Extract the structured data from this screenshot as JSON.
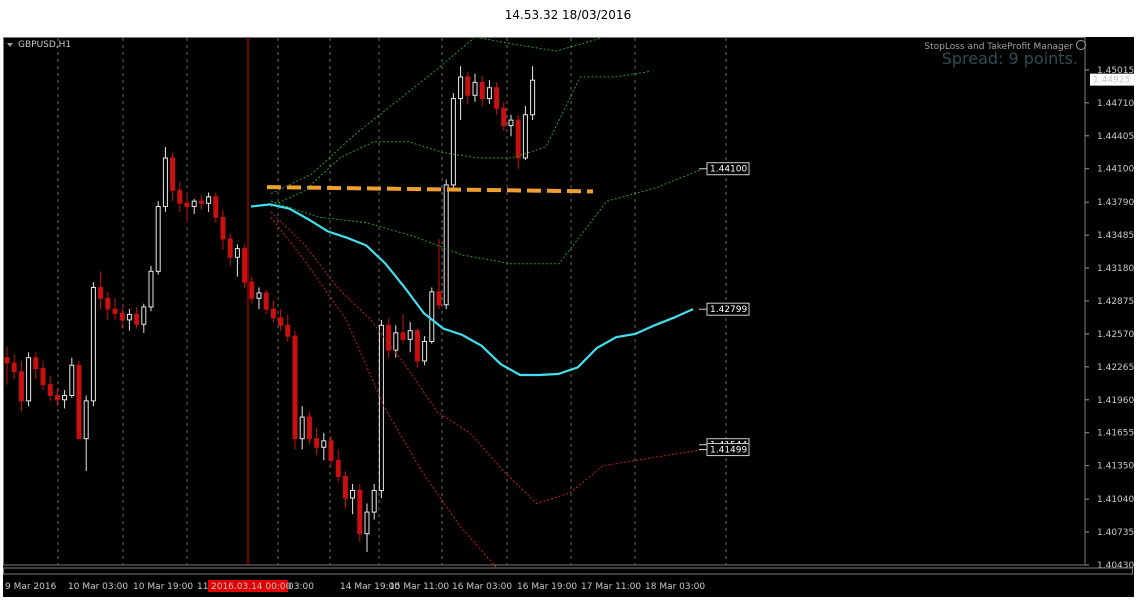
{
  "window": {
    "title": "14.53.32 18/03/2016"
  },
  "chart_header": {
    "symbol": "GBPUSD,H1"
  },
  "indicator": {
    "manager_label": "StopLoss and TakeProfit Manager",
    "spread_label": "Spread: 9 points."
  },
  "chart_data": {
    "type": "line",
    "symbol": "GBPUSD",
    "timeframe": "H1",
    "y_ticks": [
      "1.45015",
      "1.44710",
      "1.44405",
      "1.44100",
      "1.43790",
      "1.43485",
      "1.43180",
      "1.42875",
      "1.42570",
      "1.42265",
      "1.41960",
      "1.41655",
      "1.41350",
      "1.41040",
      "1.40735",
      "1.40430"
    ],
    "ylim": [
      1.4043,
      1.4532
    ],
    "current_price": "1.44925",
    "x_ticks": [
      "9 Mar 2016",
      "10 Mar 03:00",
      "10 Mar 19:00",
      "11",
      "03:00",
      "14 Mar 19:00",
      "15 Mar 11:00",
      "16 Mar 03:00",
      "16 Mar 19:00",
      "17 Mar 11:00",
      "18 Mar 03:00"
    ],
    "highlighted_time": "2016.03.14 00:00",
    "level_labels": [
      {
        "label": "1.44100",
        "value": 1.441
      },
      {
        "label": "1.42799",
        "value": 1.42799
      },
      {
        "label": "1.41544",
        "value": 1.41544
      },
      {
        "label": "1.41499",
        "value": 1.41499
      }
    ],
    "grid": true,
    "series": [
      {
        "color": "#40e0f0",
        "style": "solid",
        "values": [
          1.4375,
          1.4377,
          1.4373,
          1.4363,
          1.4352,
          1.4346,
          1.4339,
          1.4322,
          1.43,
          1.4276,
          1.4262,
          1.4256,
          1.4246,
          1.4229,
          1.4219,
          1.4219,
          1.422,
          1.4226,
          1.4244,
          1.4254,
          1.4257,
          1.4265,
          1.4272,
          1.428
        ]
      },
      {
        "color": "#f0a030",
        "style": "dashed",
        "values": [
          1.4393,
          1.4389
        ]
      },
      {
        "color": "#2a9d2a",
        "style": "dotted",
        "values": [
          1.4387,
          1.4405,
          1.444,
          1.447,
          1.45,
          1.4532,
          1.4525,
          1.4519,
          1.453,
          1.4545,
          1.456
        ]
      },
      {
        "color": "#2a9d2a",
        "style": "dotted",
        "values": [
          1.4375,
          1.439,
          1.442,
          1.4435,
          1.4435,
          1.4425,
          1.442,
          1.442,
          1.443,
          1.4495,
          1.4495,
          1.45
        ]
      },
      {
        "color": "#2a9d2a",
        "style": "dotted",
        "values": [
          1.438,
          1.4365,
          1.436,
          1.4347,
          1.433,
          1.4322,
          1.4322,
          1.438,
          1.4392,
          1.441
        ]
      },
      {
        "color": "#c82020",
        "style": "dotted",
        "values": [
          1.437,
          1.434,
          1.43,
          1.427,
          1.423,
          1.4185,
          1.4165,
          1.413,
          1.41,
          1.411,
          1.4135,
          1.414,
          1.4145,
          1.415
        ]
      },
      {
        "color": "#c82020",
        "style": "dotted",
        "values": [
          1.4365,
          1.432,
          1.427,
          1.419,
          1.413,
          1.408,
          1.404
        ]
      }
    ],
    "candles": [
      {
        "o": 1.4235,
        "h": 1.4245,
        "l": 1.421,
        "c": 1.423
      },
      {
        "o": 1.423,
        "h": 1.4238,
        "l": 1.4215,
        "c": 1.4222
      },
      {
        "o": 1.4222,
        "h": 1.4232,
        "l": 1.4185,
        "c": 1.4195
      },
      {
        "o": 1.4195,
        "h": 1.424,
        "l": 1.419,
        "c": 1.4235
      },
      {
        "o": 1.4235,
        "h": 1.424,
        "l": 1.4215,
        "c": 1.4225
      },
      {
        "o": 1.4225,
        "h": 1.4232,
        "l": 1.4205,
        "c": 1.421
      },
      {
        "o": 1.421,
        "h": 1.4218,
        "l": 1.4195,
        "c": 1.42
      },
      {
        "o": 1.42,
        "h": 1.4206,
        "l": 1.419,
        "c": 1.4196
      },
      {
        "o": 1.4196,
        "h": 1.4205,
        "l": 1.4188,
        "c": 1.42
      },
      {
        "o": 1.42,
        "h": 1.4235,
        "l": 1.4198,
        "c": 1.4228
      },
      {
        "o": 1.4228,
        "h": 1.4232,
        "l": 1.4175,
        "c": 1.416
      },
      {
        "o": 1.416,
        "h": 1.42,
        "l": 1.413,
        "c": 1.4195
      },
      {
        "o": 1.4195,
        "h": 1.4305,
        "l": 1.419,
        "c": 1.43
      },
      {
        "o": 1.43,
        "h": 1.4315,
        "l": 1.428,
        "c": 1.429
      },
      {
        "o": 1.429,
        "h": 1.4296,
        "l": 1.427,
        "c": 1.428
      },
      {
        "o": 1.428,
        "h": 1.429,
        "l": 1.427,
        "c": 1.4276
      },
      {
        "o": 1.4276,
        "h": 1.4282,
        "l": 1.4262,
        "c": 1.427
      },
      {
        "o": 1.427,
        "h": 1.428,
        "l": 1.426,
        "c": 1.4275
      },
      {
        "o": 1.4275,
        "h": 1.4282,
        "l": 1.4262,
        "c": 1.4266
      },
      {
        "o": 1.4266,
        "h": 1.4285,
        "l": 1.4258,
        "c": 1.4282
      },
      {
        "o": 1.4282,
        "h": 1.432,
        "l": 1.4278,
        "c": 1.4315
      },
      {
        "o": 1.4315,
        "h": 1.438,
        "l": 1.4312,
        "c": 1.4375
      },
      {
        "o": 1.4375,
        "h": 1.443,
        "l": 1.437,
        "c": 1.442
      },
      {
        "o": 1.442,
        "h": 1.4425,
        "l": 1.438,
        "c": 1.439
      },
      {
        "o": 1.439,
        "h": 1.4398,
        "l": 1.437,
        "c": 1.4378
      },
      {
        "o": 1.4378,
        "h": 1.4388,
        "l": 1.436,
        "c": 1.4375
      },
      {
        "o": 1.4375,
        "h": 1.4382,
        "l": 1.4368,
        "c": 1.438
      },
      {
        "o": 1.438,
        "h": 1.4386,
        "l": 1.4372,
        "c": 1.4378
      },
      {
        "o": 1.4378,
        "h": 1.4388,
        "l": 1.437,
        "c": 1.4384
      },
      {
        "o": 1.4384,
        "h": 1.4388,
        "l": 1.436,
        "c": 1.4365
      },
      {
        "o": 1.4365,
        "h": 1.4372,
        "l": 1.4335,
        "c": 1.4345
      },
      {
        "o": 1.4345,
        "h": 1.435,
        "l": 1.432,
        "c": 1.4328
      },
      {
        "o": 1.4328,
        "h": 1.434,
        "l": 1.431,
        "c": 1.4336
      },
      {
        "o": 1.4336,
        "h": 1.434,
        "l": 1.43,
        "c": 1.4305
      },
      {
        "o": 1.4305,
        "h": 1.431,
        "l": 1.4285,
        "c": 1.429
      },
      {
        "o": 1.429,
        "h": 1.43,
        "l": 1.428,
        "c": 1.4295
      },
      {
        "o": 1.4295,
        "h": 1.4298,
        "l": 1.4275,
        "c": 1.428
      },
      {
        "o": 1.428,
        "h": 1.4288,
        "l": 1.4268,
        "c": 1.4272
      },
      {
        "o": 1.4272,
        "h": 1.428,
        "l": 1.426,
        "c": 1.4265
      },
      {
        "o": 1.4265,
        "h": 1.4275,
        "l": 1.425,
        "c": 1.4255
      },
      {
        "o": 1.4255,
        "h": 1.426,
        "l": 1.415,
        "c": 1.416
      },
      {
        "o": 1.416,
        "h": 1.419,
        "l": 1.415,
        "c": 1.418
      },
      {
        "o": 1.418,
        "h": 1.4185,
        "l": 1.4155,
        "c": 1.416
      },
      {
        "o": 1.416,
        "h": 1.417,
        "l": 1.4145,
        "c": 1.4152
      },
      {
        "o": 1.4152,
        "h": 1.4165,
        "l": 1.414,
        "c": 1.4158
      },
      {
        "o": 1.4158,
        "h": 1.4162,
        "l": 1.4135,
        "c": 1.414
      },
      {
        "o": 1.414,
        "h": 1.415,
        "l": 1.412,
        "c": 1.4125
      },
      {
        "o": 1.4125,
        "h": 1.413,
        "l": 1.4095,
        "c": 1.4105
      },
      {
        "o": 1.4105,
        "h": 1.4118,
        "l": 1.409,
        "c": 1.4112
      },
      {
        "o": 1.4112,
        "h": 1.4118,
        "l": 1.4065,
        "c": 1.4072
      },
      {
        "o": 1.4072,
        "h": 1.41,
        "l": 1.4055,
        "c": 1.4092
      },
      {
        "o": 1.4092,
        "h": 1.4118,
        "l": 1.4085,
        "c": 1.4112
      },
      {
        "o": 1.4112,
        "h": 1.427,
        "l": 1.4105,
        "c": 1.4265
      },
      {
        "o": 1.4265,
        "h": 1.4272,
        "l": 1.4235,
        "c": 1.4242
      },
      {
        "o": 1.4242,
        "h": 1.4265,
        "l": 1.4235,
        "c": 1.4258
      },
      {
        "o": 1.4258,
        "h": 1.4275,
        "l": 1.4248,
        "c": 1.4252
      },
      {
        "o": 1.4252,
        "h": 1.4268,
        "l": 1.424,
        "c": 1.426
      },
      {
        "o": 1.426,
        "h": 1.4262,
        "l": 1.4225,
        "c": 1.4232
      },
      {
        "o": 1.4232,
        "h": 1.4255,
        "l": 1.4228,
        "c": 1.425
      },
      {
        "o": 1.425,
        "h": 1.43,
        "l": 1.4248,
        "c": 1.4296
      },
      {
        "o": 1.4296,
        "h": 1.4345,
        "l": 1.428,
        "c": 1.4284
      },
      {
        "o": 1.4284,
        "h": 1.44,
        "l": 1.428,
        "c": 1.4395
      },
      {
        "o": 1.4395,
        "h": 1.448,
        "l": 1.439,
        "c": 1.4475
      },
      {
        "o": 1.4475,
        "h": 1.4505,
        "l": 1.4455,
        "c": 1.4495
      },
      {
        "o": 1.4495,
        "h": 1.45,
        "l": 1.447,
        "c": 1.4478
      },
      {
        "o": 1.4478,
        "h": 1.4498,
        "l": 1.4472,
        "c": 1.449
      },
      {
        "o": 1.449,
        "h": 1.4496,
        "l": 1.4468,
        "c": 1.4475
      },
      {
        "o": 1.4475,
        "h": 1.4492,
        "l": 1.447,
        "c": 1.4485
      },
      {
        "o": 1.4485,
        "h": 1.449,
        "l": 1.446,
        "c": 1.4466
      },
      {
        "o": 1.4466,
        "h": 1.4472,
        "l": 1.4445,
        "c": 1.445
      },
      {
        "o": 1.445,
        "h": 1.446,
        "l": 1.444,
        "c": 1.4455
      },
      {
        "o": 1.4455,
        "h": 1.446,
        "l": 1.441,
        "c": 1.442
      },
      {
        "o": 1.442,
        "h": 1.4468,
        "l": 1.4418,
        "c": 1.446
      },
      {
        "o": 1.446,
        "h": 1.4505,
        "l": 1.4455,
        "c": 1.4492
      }
    ]
  },
  "colors": {
    "background": "#000000",
    "grid": "#6a6a6a",
    "bull": "#e8e8e8",
    "bear": "#c81010",
    "highlight": "#e00000",
    "axis_text": "#c8c8c8"
  }
}
